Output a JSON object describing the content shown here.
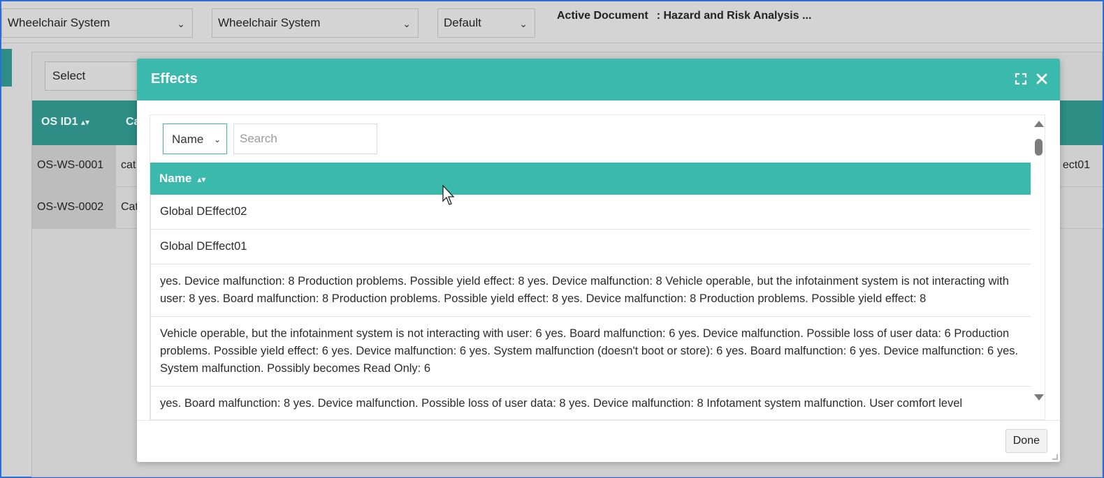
{
  "topbar": {
    "select1": "Wheelchair System",
    "select2": "Wheelchair System",
    "select3": "Default",
    "active_doc_label": "Active Document",
    "active_doc_value": ": Hazard and Risk Analysis ..."
  },
  "panel": {
    "select_label": "Select",
    "columns": [
      "OS ID1",
      "Ca"
    ],
    "rows": [
      {
        "id": "OS-WS-0001",
        "cat": "cat",
        "right": "ect01"
      },
      {
        "id": "OS-WS-0002",
        "cat": "Cat",
        "right": ""
      }
    ]
  },
  "modal": {
    "title": "Effects",
    "filter_value": "Name",
    "search_placeholder": "Search",
    "column_header": "Name",
    "rows": [
      "Global DEffect02",
      "Global DEffect01",
      "yes. Device malfunction: 8 Production problems. Possible yield effect: 8 yes. Device malfunction: 8 Vehicle operable, but the infotainment system is not interacting with user: 8 yes. Board malfunction: 8 Production problems. Possible yield effect: 8 yes. Device malfunction: 8 Production problems. Possible yield effect: 8",
      "Vehicle operable, but the infotainment system is not interacting with user: 6 yes. Board malfunction: 6 yes. Device malfunction. Possible loss of user data: 6 Production problems. Possible yield effect: 6 yes. Device malfunction: 6 yes. System malfunction (doesn't boot or store): 6 yes. Board malfunction: 6 yes. Device malfunction: 6 yes. System malfunction. Possibly becomes Read Only: 6",
      "yes. Board malfunction: 8 yes. Device malfunction. Possible loss of user data: 8 yes. Device malfunction: 8 Infotament system malfunction. User comfort level"
    ],
    "done_label": "Done"
  },
  "colors": {
    "modal_accent": "#3ab9ac",
    "background_accent": "#2e8d84"
  }
}
